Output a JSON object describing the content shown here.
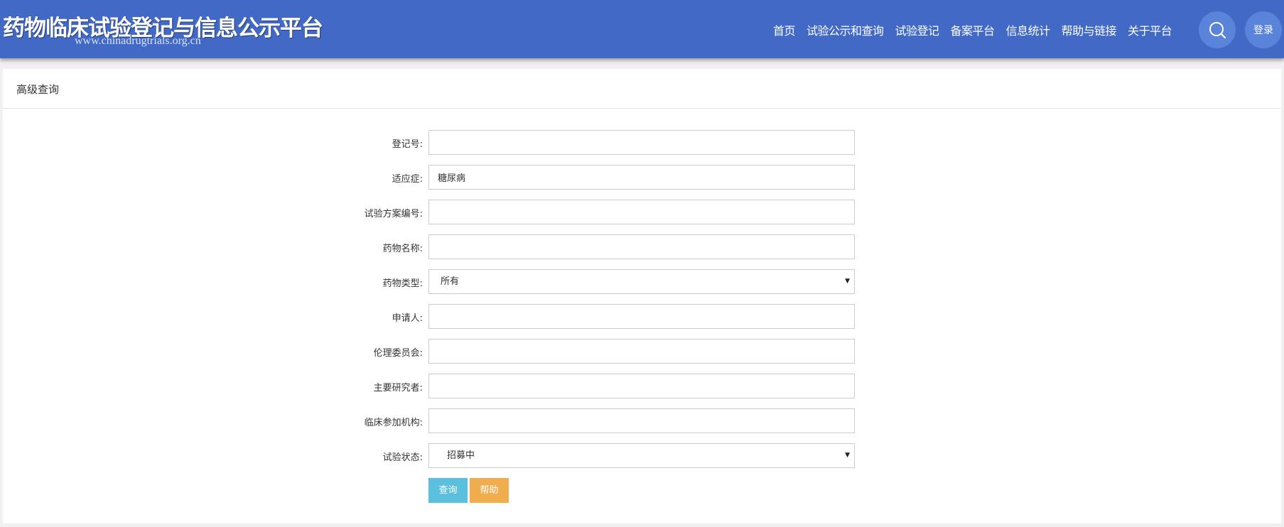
{
  "header": {
    "title": "药物临床试验登记与信息公示平台",
    "url": "www.chinadrugtrials.org.cn",
    "nav": [
      "首页",
      "试验公示和查询",
      "试验登记",
      "备案平台",
      "信息统计",
      "帮助与链接",
      "关于平台"
    ],
    "search_icon": "search-icon",
    "login_label": "登录"
  },
  "panel": {
    "title": "高级查询"
  },
  "form": {
    "reg_no": {
      "label": "登记号:",
      "value": ""
    },
    "indication": {
      "label": "适应症:",
      "value": "糖尿病"
    },
    "protocol_no": {
      "label": "试验方案编号:",
      "value": ""
    },
    "drug_name": {
      "label": "药物名称:",
      "value": ""
    },
    "drug_type": {
      "label": "药物类型:",
      "value": "所有"
    },
    "applicant": {
      "label": "申请人:",
      "value": ""
    },
    "ethics": {
      "label": "伦理委员会:",
      "value": ""
    },
    "investigator": {
      "label": "主要研究者:",
      "value": ""
    },
    "institution": {
      "label": "临床参加机构:",
      "value": ""
    },
    "status": {
      "label": "试验状态:",
      "value": "招募中"
    },
    "query_label": "查询",
    "help_label": "帮助"
  },
  "colors": {
    "header_bg": "#4169c5",
    "query_btn": "#5bc0de",
    "help_btn": "#f0ad4e"
  }
}
